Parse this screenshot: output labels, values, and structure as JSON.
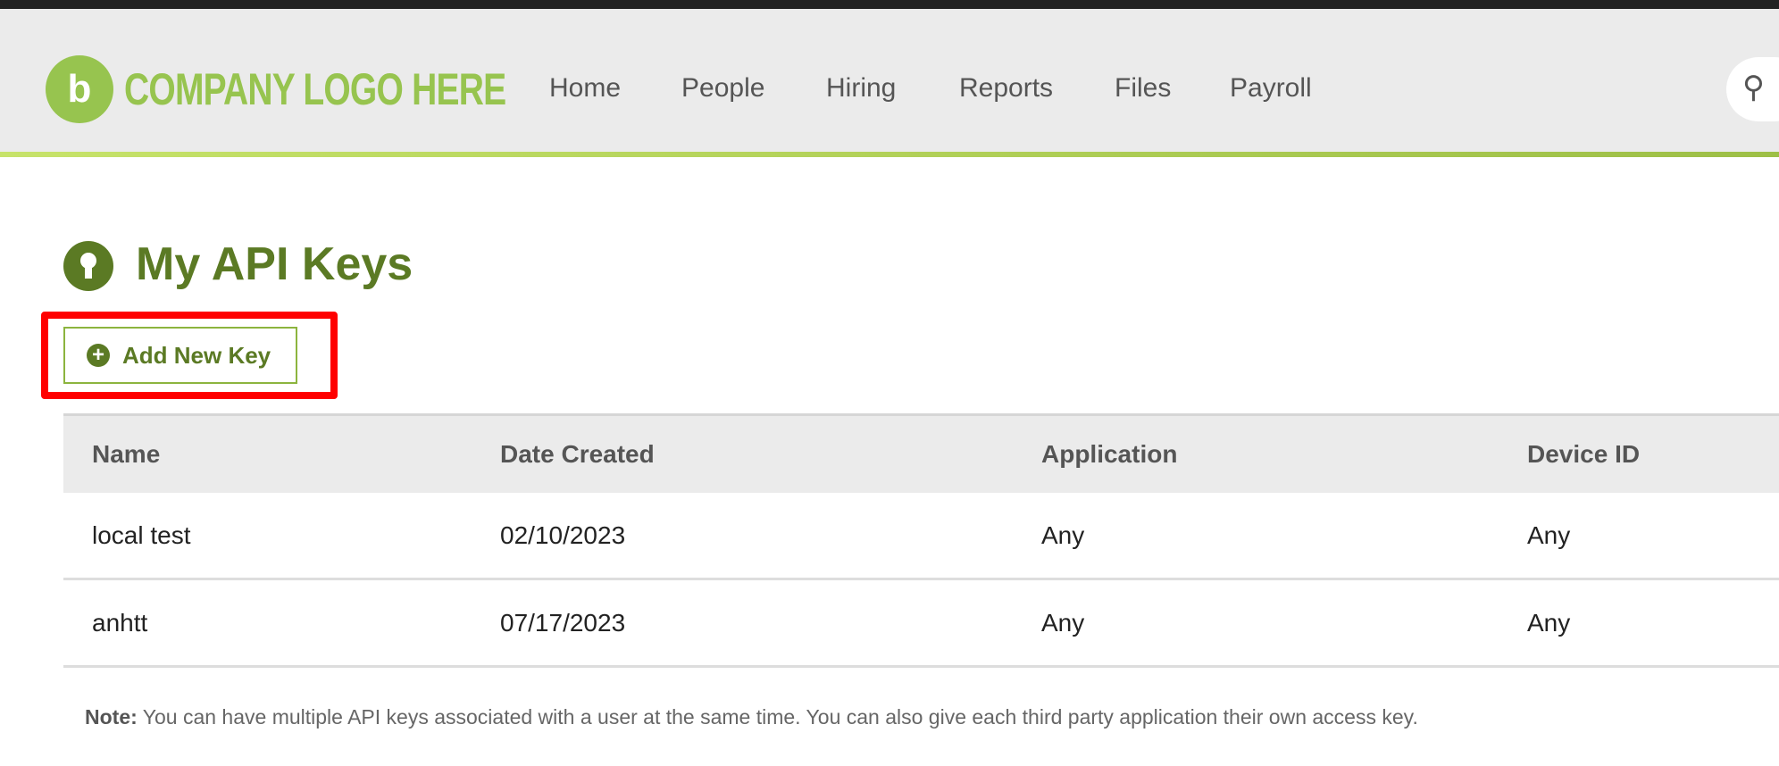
{
  "header": {
    "logo_icon": "b",
    "logo_text": "COMPANY LOGO HERE",
    "nav": [
      "Home",
      "People",
      "Hiring",
      "Reports",
      "Files",
      "Payroll"
    ],
    "search_icon": "search-icon"
  },
  "page": {
    "title": "My API Keys",
    "add_button": "Add New Key",
    "add_icon": "+"
  },
  "table": {
    "columns": [
      "Name",
      "Date Created",
      "Application",
      "Device ID"
    ],
    "rows": [
      [
        "local test",
        "02/10/2023",
        "Any",
        "Any"
      ],
      [
        "anhtt",
        "07/17/2023",
        "Any",
        "Any"
      ]
    ]
  },
  "note": {
    "label": "Note:",
    "text": " You can have multiple API keys associated with a user at the same time. You can also give each third party application their own access key."
  },
  "colors": {
    "brand": "#97c44f",
    "accent": "#5b7a24",
    "highlight": "#ff0000"
  }
}
